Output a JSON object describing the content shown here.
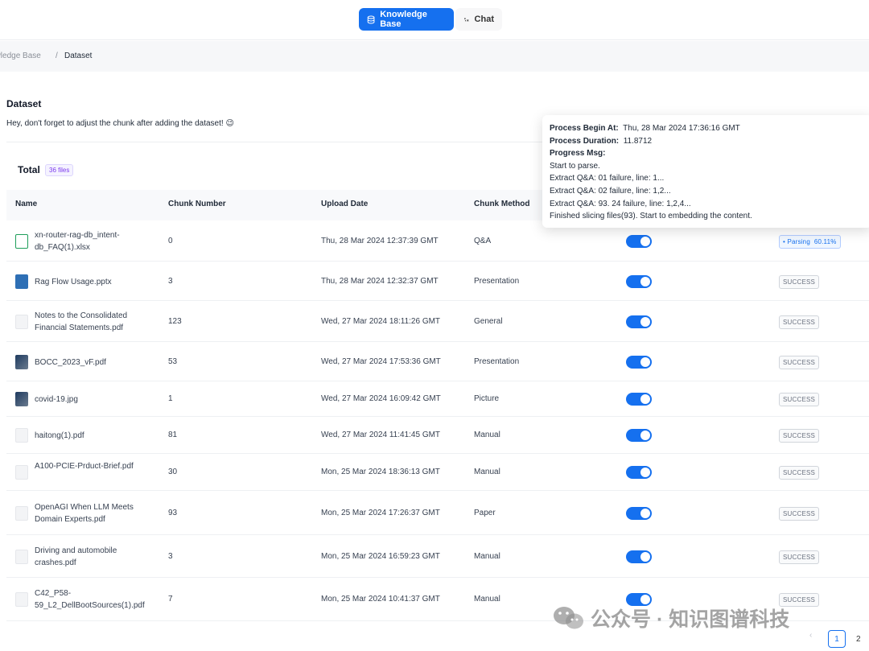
{
  "nav": {
    "kb_label": "Knowledge Base",
    "chat_label": "Chat",
    "accent": "#1570ef"
  },
  "breadcrumb": {
    "parent": "owledge Base",
    "sep": "/",
    "current": "Dataset"
  },
  "header": {
    "title": "Dataset",
    "hint": "Hey, don't forget to adjust the chunk after adding the dataset! 😉"
  },
  "summary": {
    "label": "Total",
    "count": "36 files"
  },
  "table": {
    "columns": [
      "Name",
      "Chunk Number",
      "Upload Date",
      "Chunk Method"
    ],
    "rows": [
      {
        "name": "xn-router-rag-db_intent-db_FAQ(1).xlsx",
        "chunks": "0",
        "date": "Thu, 28 Mar 2024 12:37:39 GMT",
        "method": "Q&A",
        "status": "Parsing",
        "progress": "60.11%",
        "icon": "xlsx-icon"
      },
      {
        "name": "Rag Flow Usage.pptx",
        "chunks": "3",
        "date": "Thu, 28 Mar 2024 12:32:37 GMT",
        "method": "Presentation",
        "status": "SUCCESS",
        "icon": "pptx-icon"
      },
      {
        "name": "Notes to the Consolidated Financial Statements.pdf",
        "chunks": "123",
        "date": "Wed, 27 Mar 2024 18:11:26 GMT",
        "method": "General",
        "status": "SUCCESS",
        "icon": "pdf-icon"
      },
      {
        "name": "BOCC_2023_vF.pdf",
        "chunks": "53",
        "date": "Wed, 27 Mar 2024 17:53:36 GMT",
        "method": "Presentation",
        "status": "SUCCESS",
        "icon": "image-thumb-icon"
      },
      {
        "name": "covid-19.jpg",
        "chunks": "1",
        "date": "Wed, 27 Mar 2024 16:09:42 GMT",
        "method": "Picture",
        "status": "SUCCESS",
        "icon": "image-thumb-icon"
      },
      {
        "name": "haitong(1).pdf",
        "chunks": "81",
        "date": "Wed, 27 Mar 2024 11:41:45 GMT",
        "method": "Manual",
        "status": "SUCCESS",
        "icon": "pdf-icon"
      },
      {
        "name": "A100-PCIE-Prduct-Brief.pdf",
        "chunks": "30",
        "date": "Mon, 25 Mar 2024 18:36:13 GMT",
        "method": "Manual",
        "status": "SUCCESS",
        "icon": "pdf-icon"
      },
      {
        "name": "OpenAGI When LLM Meets Domain Experts.pdf",
        "chunks": "93",
        "date": "Mon, 25 Mar 2024 17:26:37 GMT",
        "method": "Paper",
        "status": "SUCCESS",
        "icon": "pdf-icon"
      },
      {
        "name": "Driving and automobile crashes.pdf",
        "chunks": "3",
        "date": "Mon, 25 Mar 2024 16:59:23 GMT",
        "method": "Manual",
        "status": "SUCCESS",
        "icon": "pdf-icon"
      },
      {
        "name": "C42_P58-59_L2_DellBootSources(1).pdf",
        "chunks": "7",
        "date": "Mon, 25 Mar 2024 10:41:37 GMT",
        "method": "Manual",
        "status": "SUCCESS",
        "icon": "pdf-icon"
      }
    ]
  },
  "tooltip": {
    "begin_label": "Process Begin At:",
    "begin_value": "Thu, 28 Mar 2024 17:36:16 GMT",
    "duration_label": "Process Duration:",
    "duration_value": "11.8712",
    "msg_label": "Progress Msg:",
    "lines": [
      "Start to parse.",
      "Extract Q&A: 01 failure, line: 1...",
      "Extract Q&A: 02 failure, line: 1,2...",
      "Extract Q&A: 93. 24 failure, line: 1,2,4...",
      "Finished slicing files(93). Start to embedding the content."
    ]
  },
  "pagination": {
    "prev": "‹",
    "page1": "1",
    "page2": "2"
  },
  "watermark": "公众号 · 知识图谱科技"
}
